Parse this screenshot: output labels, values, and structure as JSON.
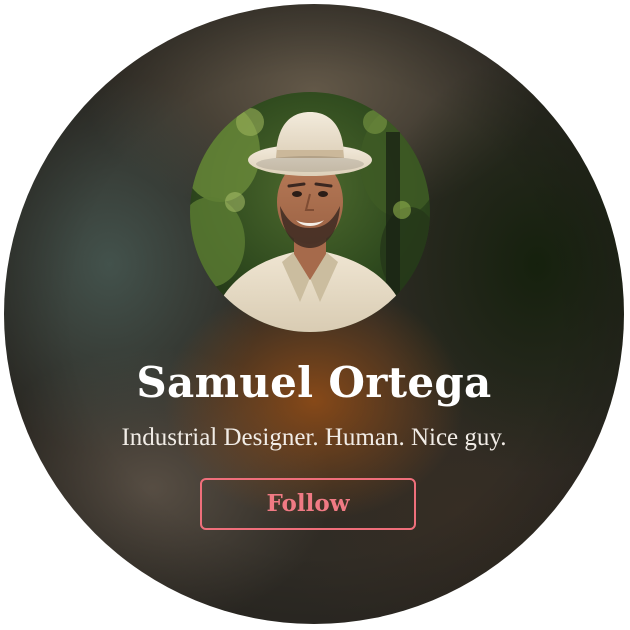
{
  "profile": {
    "name": "Samuel Ortega",
    "bio": "Industrial Designer. Human. Nice guy.",
    "avatar_icon": "profile-photo-icon"
  },
  "actions": {
    "follow_label": "Follow"
  },
  "colors": {
    "accent": "#ef6f7b",
    "name_text": "#ffffff",
    "bio_text": "#f1ece6"
  }
}
